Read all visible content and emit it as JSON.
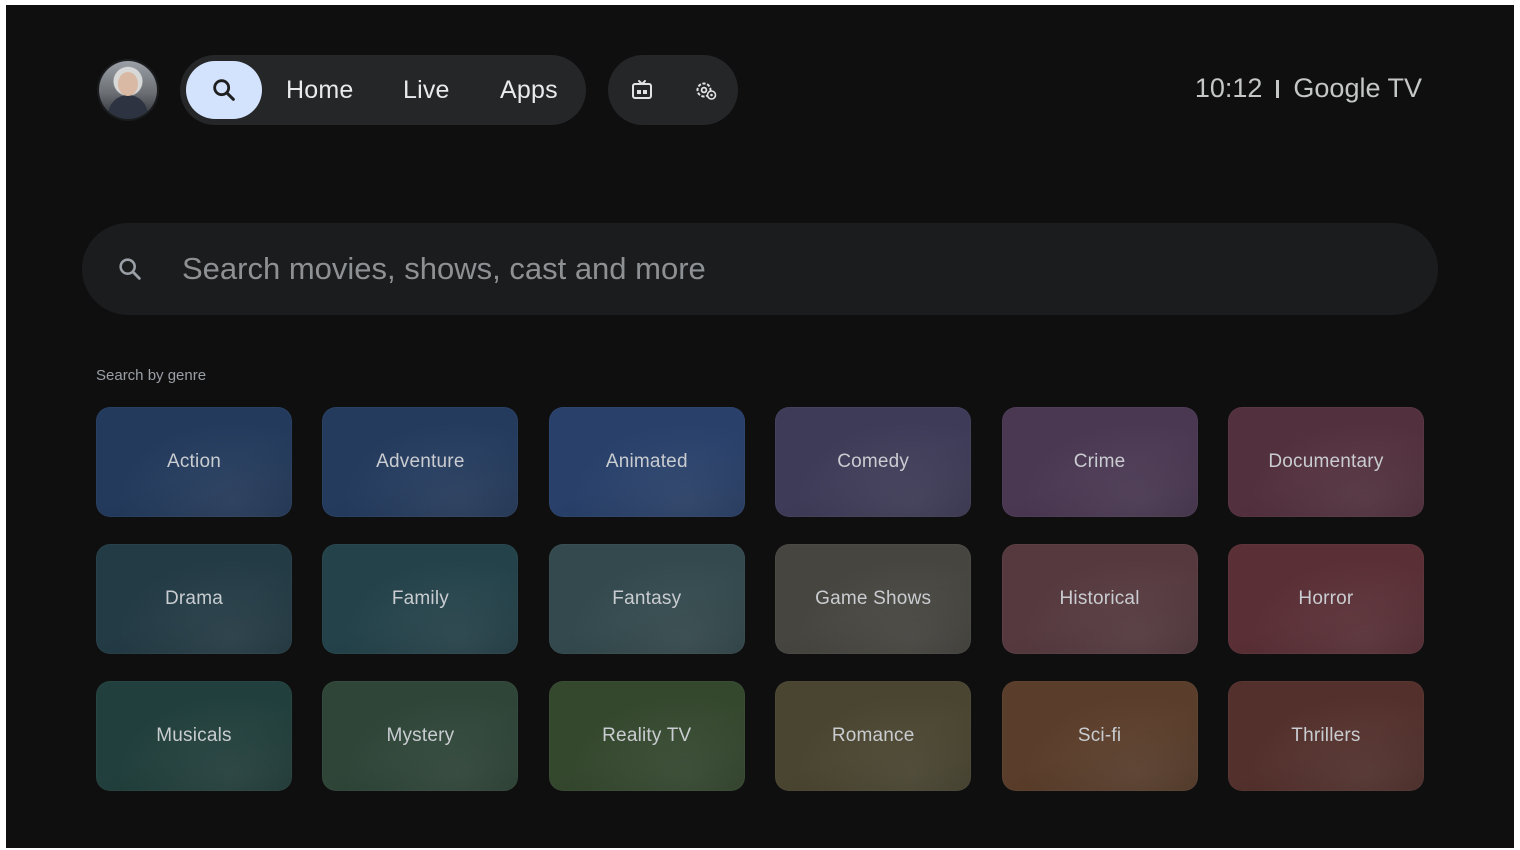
{
  "nav": {
    "items": [
      {
        "label": "Home"
      },
      {
        "label": "Live"
      },
      {
        "label": "Apps"
      }
    ],
    "search_icon": "search-icon",
    "utility_icons": [
      "input-source-icon",
      "settings-gear-icon"
    ]
  },
  "status": {
    "time": "10:12",
    "brand": "Google TV"
  },
  "search": {
    "placeholder": "Search movies, shows, cast and more"
  },
  "genres": {
    "title": "Search by genre",
    "items": [
      {
        "label": "Action",
        "color": "#233a5c"
      },
      {
        "label": "Adventure",
        "color": "#243b5e"
      },
      {
        "label": "Animated",
        "color": "#28406a"
      },
      {
        "label": "Comedy",
        "color": "#3e3b58"
      },
      {
        "label": "Crime",
        "color": "#4a3752"
      },
      {
        "label": "Documentary",
        "color": "#53303e"
      },
      {
        "label": "Drama",
        "color": "#233b45"
      },
      {
        "label": "Family",
        "color": "#24424a"
      },
      {
        "label": "Fantasy",
        "color": "#33494d"
      },
      {
        "label": "Game Shows",
        "color": "#46453f"
      },
      {
        "label": "Historical",
        "color": "#55393e"
      },
      {
        "label": "Horror",
        "color": "#5a2f36"
      },
      {
        "label": "Musicals",
        "color": "#213f3c"
      },
      {
        "label": "Mystery",
        "color": "#2e4538"
      },
      {
        "label": "Reality TV",
        "color": "#34482e"
      },
      {
        "label": "Romance",
        "color": "#4a4530"
      },
      {
        "label": "Sci-fi",
        "color": "#5a3d2a"
      },
      {
        "label": "Thrillers",
        "color": "#53302c"
      }
    ]
  }
}
